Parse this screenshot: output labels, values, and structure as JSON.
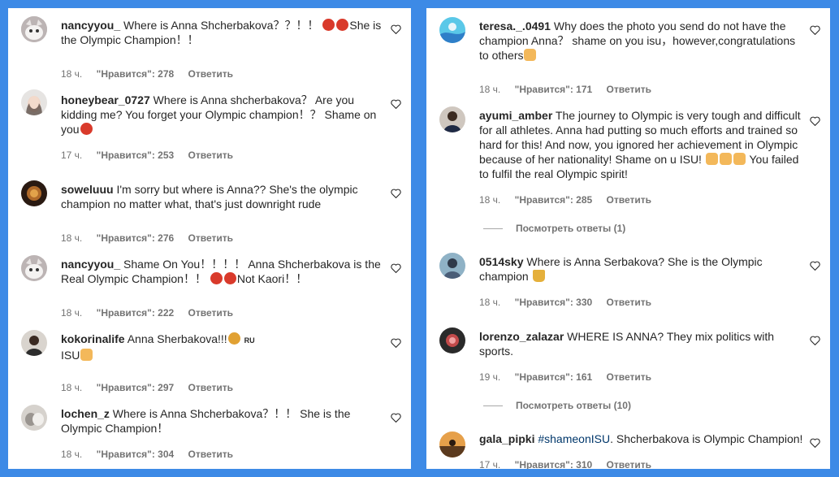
{
  "left_panel": {
    "comments": [
      {
        "username": "nancyyou_",
        "text_before": "Where is Anna Shcherbakova？？！！",
        "emoji_mid": [
          "angry-face",
          "angry-face"
        ],
        "text_after": "She is the Olympic Champion！！",
        "time": "18 ч.",
        "likes": "\"Нравится\": 278",
        "reply": "Ответить"
      },
      {
        "username": "honeybear_0727",
        "text_before": "Where is Anna shcherbakova？ Are you kidding me? You forget your Olympic champion！？ Shame on you",
        "emoji_end": [
          "cursing-face"
        ],
        "time": "17 ч.",
        "likes": "\"Нравится\": 253",
        "reply": "Ответить"
      },
      {
        "username": "soweluuu",
        "text_before": "I'm sorry but where is Anna?? She's the olympic champion no matter what, that's just downright rude",
        "time": "18 ч.",
        "likes": "\"Нравится\": 276",
        "reply": "Ответить"
      },
      {
        "username": "nancyyou_",
        "text_before": "Shame On You！！！！ Anna Shcherbakova is the Real Olympic Champion！！",
        "emoji_mid": [
          "angry-face",
          "angry-face"
        ],
        "text_after": "Not Kaori！！",
        "time": "18 ч.",
        "likes": "\"Нравится\": 222",
        "reply": "Ответить"
      },
      {
        "username": "kokorinalife",
        "text_before": "Anna Sherbakova!!!",
        "flag": "RU",
        "text_line2": "ISU",
        "time": "18 ч.",
        "likes": "\"Нравится\": 297",
        "reply": "Ответить"
      },
      {
        "username": "lochen_z",
        "text_before": "Where is Anna Shcherbakova？！！ She is the Olympic Champion！",
        "time": "18 ч.",
        "likes": "\"Нравится\": 304",
        "reply": "Ответить"
      }
    ]
  },
  "right_panel": {
    "comments": [
      {
        "username": "teresa._.0491",
        "text_before": "Why does the photo you send do not have the champion Anna？ shame on you isu，however,congratulations to others",
        "time": "18 ч.",
        "likes": "\"Нравится\": 171",
        "reply": "Ответить"
      },
      {
        "username": "ayumi_amber",
        "text_before": "The journey to Olympic is very tough and difficult for all athletes. Anna had putting so much efforts and trained so hard for this! And now, you ignored her achievement in Olympic because of her nationality! Shame on u ISU!",
        "text_after": "You failed to fulfil the real Olympic spirit!",
        "time": "18 ч.",
        "likes": "\"Нравится\": 285",
        "reply": "Ответить",
        "replies": "Посмотреть ответы (1)"
      },
      {
        "username": "0514sky",
        "text_before": "Where is Anna Serbakova? She is the Olympic champion",
        "time": "18 ч.",
        "likes": "\"Нравится\": 330",
        "reply": "Ответить"
      },
      {
        "username": "lorenzo_zalazar",
        "text_before": "WHERE IS ANNA? They mix politics with sports.",
        "time": "19 ч.",
        "likes": "\"Нравится\": 161",
        "reply": "Ответить",
        "replies": "Посмотреть ответы (10)"
      },
      {
        "username": "gala_pipki",
        "hashtag": "#shameonISU",
        "text_before": ". Shcherbakova is Olympic Champion!",
        "time": "17 ч.",
        "likes": "\"Нравится\": 310",
        "reply": "Ответить"
      }
    ]
  },
  "colors": {
    "background": "#3d8ae6",
    "panel": "#ffffff",
    "text": "#262626",
    "meta": "#737373",
    "hashtag": "#00376b"
  }
}
